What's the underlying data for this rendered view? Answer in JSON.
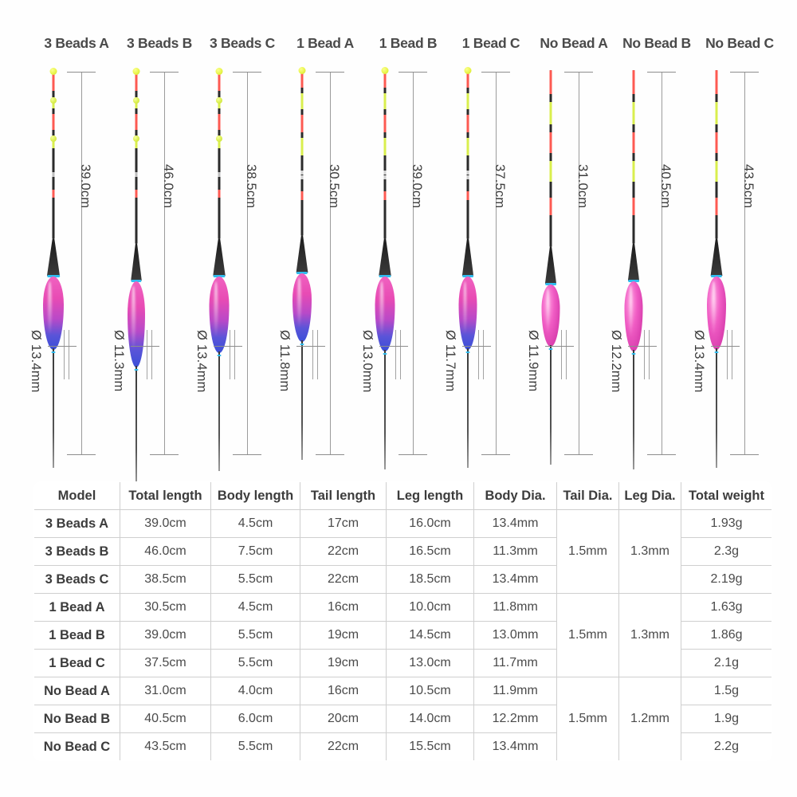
{
  "floats": [
    {
      "title": "3 Beads A",
      "total_length_label": "39.0cm",
      "diameter_label": "Ø 13.4mm",
      "beads": 3,
      "body_style": "pink-blue",
      "body_width": 26,
      "body_height": 92,
      "tail_length": 212,
      "leg_length": 150
    },
    {
      "title": "3 Beads B",
      "total_length_label": "46.0cm",
      "diameter_label": "Ø 11.3mm",
      "beads": 3,
      "body_style": "pink-blue",
      "body_width": 22,
      "body_height": 108,
      "tail_length": 218,
      "leg_length": 150
    },
    {
      "title": "3 Beads C",
      "total_length_label": "38.5cm",
      "diameter_label": "Ø 13.4mm",
      "beads": 3,
      "body_style": "pink-blue",
      "body_width": 25,
      "body_height": 96,
      "tail_length": 212,
      "leg_length": 150
    },
    {
      "title": "1 Bead A",
      "total_length_label": "30.5cm",
      "diameter_label": "Ø 11.8mm",
      "beads": 1,
      "body_style": "pink-blue",
      "body_width": 24,
      "body_height": 86,
      "tail_length": 208,
      "leg_length": 150
    },
    {
      "title": "1 Bead B",
      "total_length_label": "39.0cm",
      "diameter_label": "Ø 13.0mm",
      "beads": 1,
      "body_style": "pink-blue",
      "body_width": 25,
      "body_height": 94,
      "tail_length": 212,
      "leg_length": 150
    },
    {
      "title": "1 Bead C",
      "total_length_label": "37.5cm",
      "diameter_label": "Ø 11.7mm",
      "beads": 1,
      "body_style": "pink-blue",
      "body_width": 23,
      "body_height": 92,
      "tail_length": 212,
      "leg_length": 150
    },
    {
      "title": "No Bead A",
      "total_length_label": "31.0cm",
      "diameter_label": "Ø 11.9mm",
      "beads": 0,
      "body_style": "pink",
      "body_width": 23,
      "body_height": 78,
      "tail_length": 222,
      "leg_length": 150
    },
    {
      "title": "No Bead B",
      "total_length_label": "40.5cm",
      "diameter_label": "Ø 12.2mm",
      "beads": 0,
      "body_style": "pink",
      "body_width": 23,
      "body_height": 88,
      "tail_length": 218,
      "leg_length": 150
    },
    {
      "title": "No Bead C",
      "total_length_label": "43.5cm",
      "diameter_label": "Ø 13.4mm",
      "beads": 0,
      "body_style": "pink",
      "body_width": 24,
      "body_height": 92,
      "tail_length": 212,
      "leg_length": 150
    }
  ],
  "table": {
    "headers": [
      "Model",
      "Total length",
      "Body length",
      "Tail length",
      "Leg length",
      "Body Dia.",
      "Tail Dia.",
      "Leg Dia.",
      "Total weight"
    ],
    "rows": [
      {
        "model": "3 Beads A",
        "total_length": "39.0cm",
        "body_length": "4.5cm",
        "tail_length": "17cm",
        "leg_length": "16.0cm",
        "body_dia": "13.4mm",
        "total_weight": "1.93g"
      },
      {
        "model": "3 Beads B",
        "total_length": "46.0cm",
        "body_length": "7.5cm",
        "tail_length": "22cm",
        "leg_length": "16.5cm",
        "body_dia": "11.3mm",
        "total_weight": "2.3g"
      },
      {
        "model": "3 Beads C",
        "total_length": "38.5cm",
        "body_length": "5.5cm",
        "tail_length": "22cm",
        "leg_length": "18.5cm",
        "body_dia": "13.4mm",
        "total_weight": "2.19g"
      },
      {
        "model": "1 Bead A",
        "total_length": "30.5cm",
        "body_length": "4.5cm",
        "tail_length": "16cm",
        "leg_length": "10.0cm",
        "body_dia": "11.8mm",
        "total_weight": "1.63g"
      },
      {
        "model": "1 Bead B",
        "total_length": "39.0cm",
        "body_length": "5.5cm",
        "tail_length": "19cm",
        "leg_length": "14.5cm",
        "body_dia": "13.0mm",
        "total_weight": "1.86g"
      },
      {
        "model": "1 Bead C",
        "total_length": "37.5cm",
        "body_length": "5.5cm",
        "tail_length": "19cm",
        "leg_length": "13.0cm",
        "body_dia": "11.7mm",
        "total_weight": "2.1g"
      },
      {
        "model": "No Bead A",
        "total_length": "31.0cm",
        "body_length": "4.0cm",
        "tail_length": "16cm",
        "leg_length": "10.5cm",
        "body_dia": "11.9mm",
        "total_weight": "1.5g"
      },
      {
        "model": "No Bead B",
        "total_length": "40.5cm",
        "body_length": "6.0cm",
        "tail_length": "20cm",
        "leg_length": "14.0cm",
        "body_dia": "12.2mm",
        "total_weight": "1.9g"
      },
      {
        "model": "No Bead C",
        "total_length": "43.5cm",
        "body_length": "5.5cm",
        "tail_length": "22cm",
        "leg_length": "15.5cm",
        "body_dia": "13.4mm",
        "total_weight": "2.2g"
      }
    ],
    "merged_groups": [
      {
        "tail_dia": "1.5mm",
        "leg_dia": "1.3mm",
        "span": 3
      },
      {
        "tail_dia": "1.5mm",
        "leg_dia": "1.3mm",
        "span": 3
      },
      {
        "tail_dia": "1.5mm",
        "leg_dia": "1.2mm",
        "span": 3
      }
    ]
  },
  "colors": {
    "body_pink": "#e84bb4",
    "body_blue": "#3a4fd8",
    "tail_red": "#fd5a52",
    "tail_yellow": "#d9ef4e",
    "tail_dark": "#2b2b2b",
    "ring_blue": "#2fbdf0",
    "text": "#4a4a4a",
    "grid": "#cfcfcf",
    "dimension_line": "#9b9b9b"
  }
}
